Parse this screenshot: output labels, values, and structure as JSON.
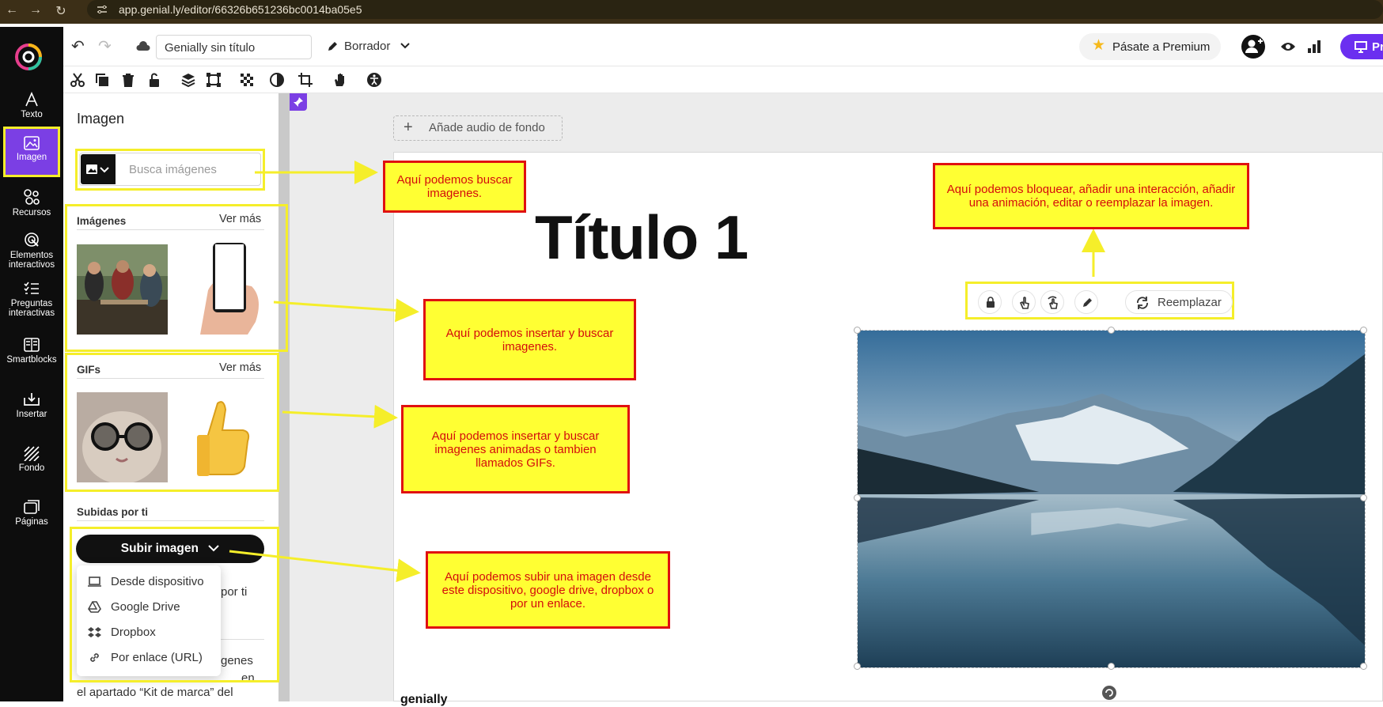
{
  "browser": {
    "url": "app.genial.ly/editor/66326b651236bc0014ba05e5"
  },
  "sidebar": {
    "items": [
      {
        "label": "Texto",
        "icon": "text-icon"
      },
      {
        "label": "Imagen",
        "icon": "image-icon",
        "active": true
      },
      {
        "label": "Recursos",
        "icon": "resources-icon"
      },
      {
        "label": "Elementos interactivos",
        "icon": "interactive-icon"
      },
      {
        "label": "Preguntas interactivas",
        "icon": "questions-icon"
      },
      {
        "label": "Smartblocks",
        "icon": "smartblocks-icon"
      },
      {
        "label": "Insertar",
        "icon": "insert-icon"
      },
      {
        "label": "Fondo",
        "icon": "background-icon"
      },
      {
        "label": "Páginas",
        "icon": "pages-icon"
      }
    ]
  },
  "topbar": {
    "title_value": "Genially sin título",
    "draft_label": "Borrador",
    "premium_label": "Pásate a Premium",
    "present_label": "Pr"
  },
  "panel": {
    "title": "Imagen",
    "search_placeholder": "Busca imágenes",
    "images_title": "Imágenes",
    "images_more": "Ver más",
    "gifs_title": "GIFs",
    "gifs_more": "Ver más",
    "uploads_title": "Subidas por ti",
    "upload_button": "Subir imagen",
    "upload_menu": [
      {
        "label": "Desde dispositivo",
        "icon": "laptop-icon"
      },
      {
        "label": "Google Drive",
        "icon": "google-drive-icon"
      },
      {
        "label": "Dropbox",
        "icon": "dropbox-icon"
      },
      {
        "label": "Por enlace (URL)",
        "icon": "link-icon"
      }
    ],
    "partial_text_1": "por ti",
    "partial_text_2": "genes",
    "partial_text_3": "en",
    "partial_text_4": "el apartado “Kit de marca” del"
  },
  "canvas": {
    "audio_button": "Añade audio de fondo",
    "slide_title": "Título 1",
    "replace_button": "Reemplazar",
    "brand": "genially"
  },
  "notes": {
    "search": "Aquí podemos buscar imagenes.",
    "insert": "Aquí podemos insertar y buscar imagenes.",
    "gifs": "Aquí podemos insertar y buscar imagenes animadas o tambien llamados GIFs.",
    "upload": "Aquí podemos subir una imagen desde este dispositivo, google drive, dropbox o por un enlace.",
    "toolbar": "Aquí podemos bloquear, añadir una interacción, añadir una animación, editar o reemplazar la imagen."
  },
  "colors": {
    "accent": "#7b3fe4",
    "highlight": "#f5ee2a",
    "note_bg": "#ffff33",
    "note_border": "#e01010",
    "note_text": "#d40c0c"
  }
}
